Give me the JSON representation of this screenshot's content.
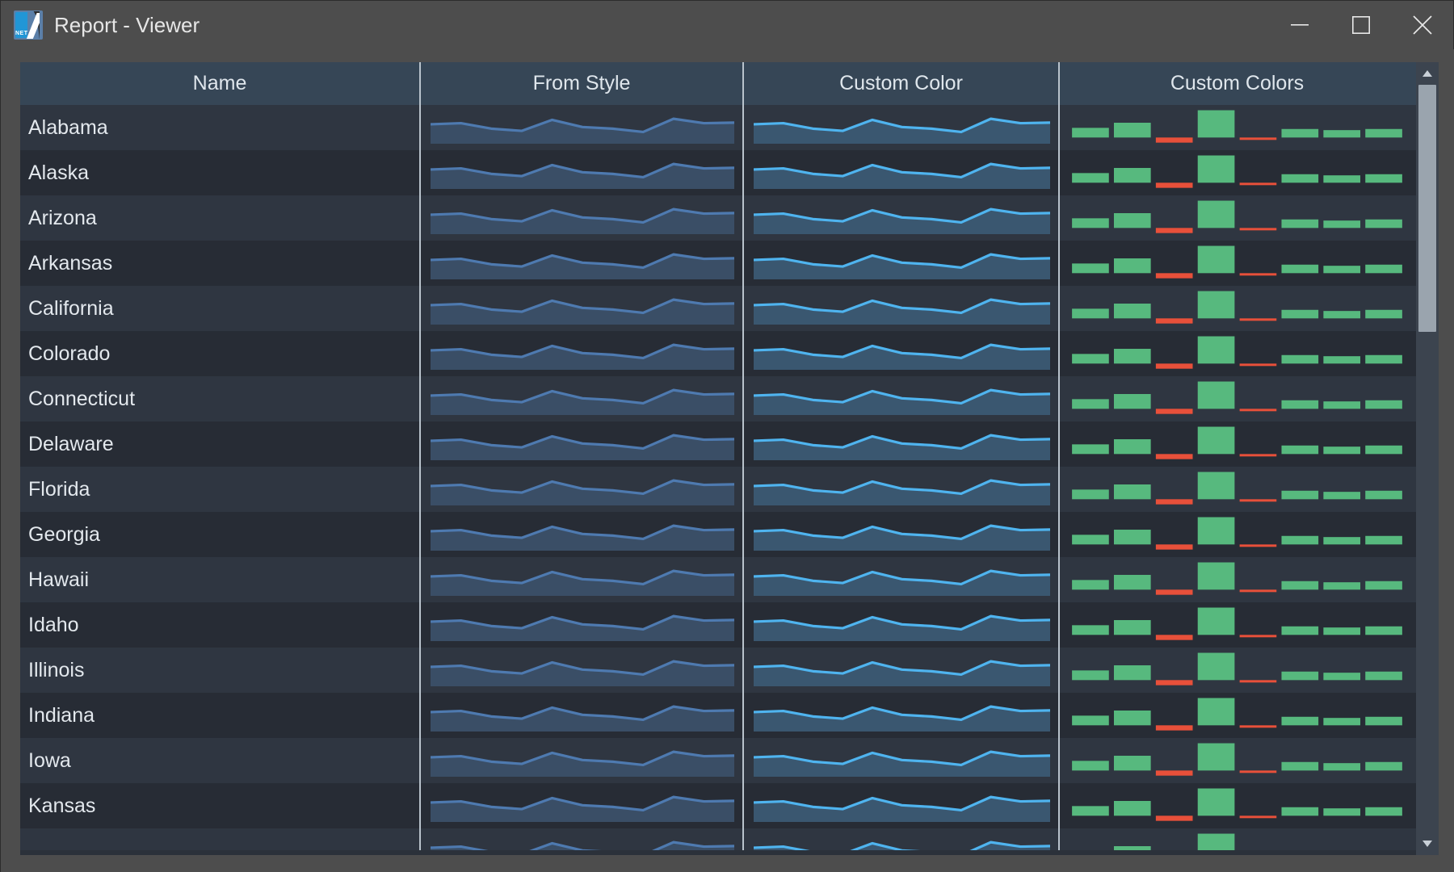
{
  "window": {
    "title": "Report - Viewer",
    "logo_label": "NET",
    "controls": {
      "minimize": "minimize-button",
      "maximize": "maximize-button",
      "close": "close-button"
    }
  },
  "colors": {
    "window_chrome": "#4d4d4d",
    "header_bg": "#364656",
    "header_text": "#dfe6ec",
    "row_odd": "#2f3641",
    "row_even": "#272c35",
    "grid_line": "#b9c3cc",
    "spark_style_line": "#4e7ab0",
    "spark_style_fill": "#3a4e66",
    "spark_custom_line": "#4fb4ef",
    "spark_custom_fill": "#3a5770",
    "bar_positive": "#57b97e",
    "bar_negative": "#e8503a",
    "scrollbar_thumb": "#9aa4ae",
    "scrollbar_track": "#3c444f"
  },
  "grid": {
    "columns": [
      {
        "key": "name",
        "label": "Name"
      },
      {
        "key": "style",
        "label": "From Style"
      },
      {
        "key": "color",
        "label": "Custom Color"
      },
      {
        "key": "colors",
        "label": "Custom Colors"
      }
    ],
    "rows": [
      {
        "name": "Alabama"
      },
      {
        "name": "Alaska"
      },
      {
        "name": "Arizona"
      },
      {
        "name": "Arkansas"
      },
      {
        "name": "California"
      },
      {
        "name": "Colorado"
      },
      {
        "name": "Connecticut"
      },
      {
        "name": "Delaware"
      },
      {
        "name": "Florida"
      },
      {
        "name": "Georgia"
      },
      {
        "name": "Hawaii"
      },
      {
        "name": "Idaho"
      },
      {
        "name": "Illinois"
      },
      {
        "name": "Indiana"
      },
      {
        "name": "Iowa"
      },
      {
        "name": "Kansas"
      },
      {
        "name": ""
      }
    ]
  },
  "chart_data": [
    {
      "type": "area",
      "name": "From Style sparkline",
      "title": "From Style",
      "xlabel": "",
      "ylabel": "",
      "grid": false,
      "legend": "none",
      "ylim": [
        0,
        100
      ],
      "x": [
        0,
        1,
        2,
        3,
        4,
        5,
        6,
        7,
        8,
        9
      ],
      "values": [
        62,
        66,
        46,
        38,
        78,
        52,
        46,
        34,
        82,
        66,
        68
      ],
      "line_color": "#4e7ab0",
      "fill_color": "#3a4e66"
    },
    {
      "type": "area",
      "name": "Custom Color sparkline",
      "title": "Custom Color",
      "xlabel": "",
      "ylabel": "",
      "grid": false,
      "legend": "none",
      "ylim": [
        0,
        100
      ],
      "x": [
        0,
        1,
        2,
        3,
        4,
        5,
        6,
        7,
        8,
        9
      ],
      "values": [
        62,
        66,
        46,
        38,
        78,
        52,
        46,
        34,
        82,
        66,
        68
      ],
      "line_color": "#4fb4ef",
      "fill_color": "#3a5770"
    },
    {
      "type": "bar",
      "name": "Custom Colors bars",
      "title": "Custom Colors",
      "xlabel": "",
      "ylabel": "",
      "grid": false,
      "legend": "none",
      "ylim": [
        -30,
        100
      ],
      "categories": [
        "1",
        "2",
        "3",
        "4",
        "5",
        "6",
        "7",
        "8"
      ],
      "values": [
        34,
        52,
        -18,
        96,
        -8,
        30,
        26,
        30
      ],
      "positive_color": "#57b97e",
      "negative_color": "#e8503a"
    }
  ],
  "scrollbar": {
    "up_arrow": "scroll-up-arrow",
    "down_arrow": "scroll-down-arrow",
    "thumb_position_pct": 0,
    "thumb_size_pct": 33
  }
}
